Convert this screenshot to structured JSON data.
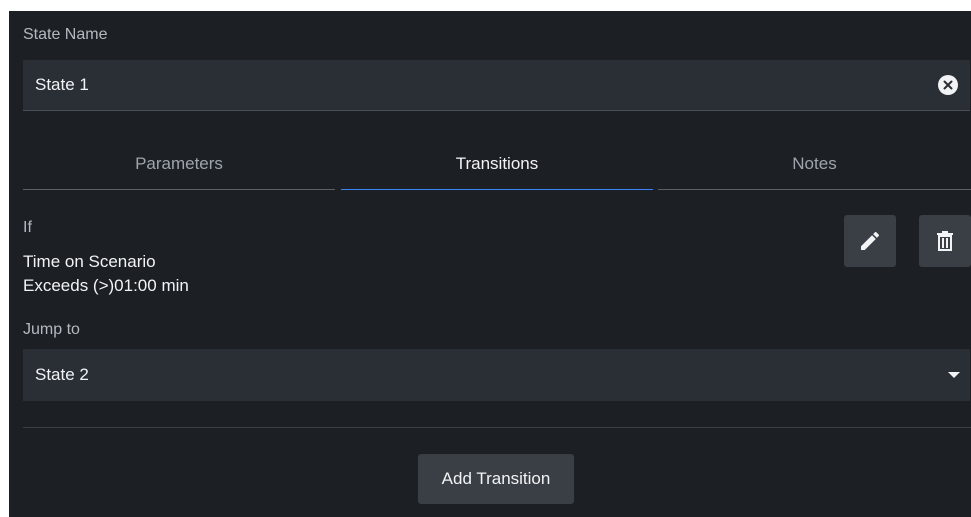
{
  "state_name": {
    "label": "State Name",
    "value": "State 1",
    "clear_icon": "clear-circle-icon"
  },
  "tabs": [
    {
      "label": "Parameters",
      "active": false
    },
    {
      "label": "Transitions",
      "active": true
    },
    {
      "label": "Notes",
      "active": false
    }
  ],
  "transition": {
    "if_label": "If",
    "condition_line1": "Time on Scenario",
    "condition_line2": "Exceeds (>)01:00 min",
    "edit_icon": "pencil-icon",
    "delete_icon": "trash-icon",
    "jump_label": "Jump to",
    "jump_value": "State 2"
  },
  "add_transition_label": "Add Transition",
  "colors": {
    "panel_bg": "#1c2025",
    "field_bg": "#2a2f35",
    "button_bg": "#3a3f45",
    "active_tab_underline": "#3b82f6"
  }
}
